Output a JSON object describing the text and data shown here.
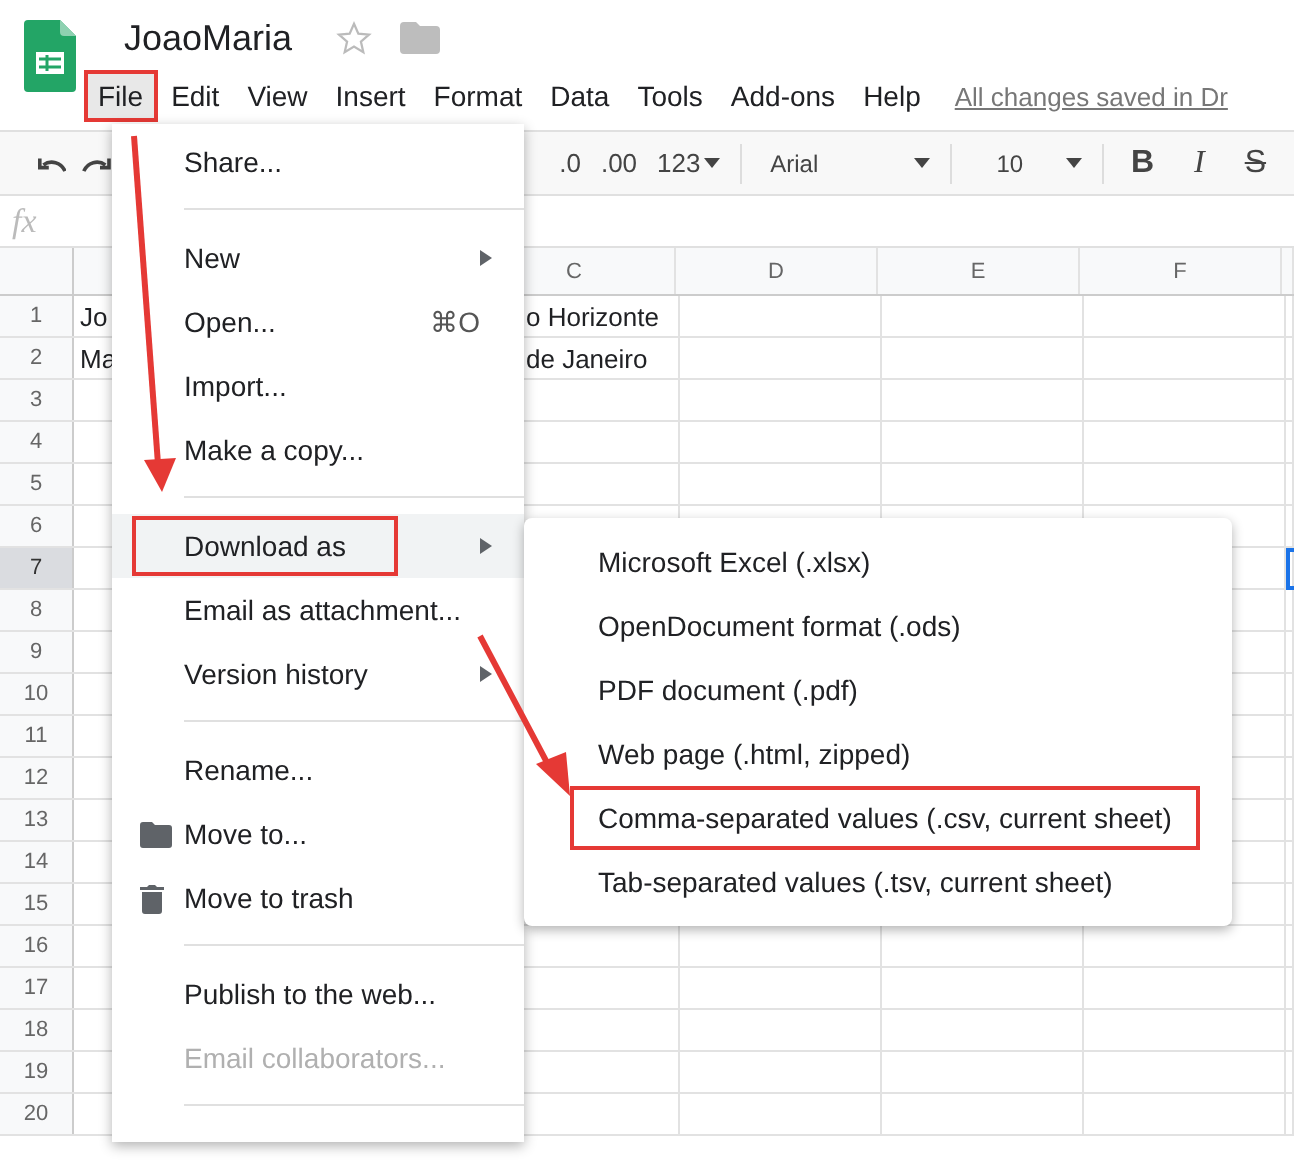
{
  "document": {
    "title": "JoaoMaria",
    "starred": false
  },
  "menubar": [
    {
      "label": "File",
      "selected": true,
      "annotated": true
    },
    {
      "label": "Edit",
      "selected": false,
      "annotated": false
    },
    {
      "label": "View",
      "selected": false,
      "annotated": false
    },
    {
      "label": "Insert",
      "selected": false,
      "annotated": false
    },
    {
      "label": "Format",
      "selected": false,
      "annotated": false
    },
    {
      "label": "Data",
      "selected": false,
      "annotated": false
    },
    {
      "label": "Tools",
      "selected": false,
      "annotated": false
    },
    {
      "label": "Add-ons",
      "selected": false,
      "annotated": false
    },
    {
      "label": "Help",
      "selected": false,
      "annotated": false
    }
  ],
  "save_status": "All changes saved in Dr",
  "toolbar": {
    "decimal_decrease": ".0",
    "decimal_increase": ".00",
    "number_format": "123",
    "font": "Arial",
    "font_size": "10",
    "bold": "B",
    "italic": "I",
    "strikethrough": "S"
  },
  "formula_bar": {
    "label": "fx"
  },
  "columns": [
    "C",
    "D",
    "E",
    "F"
  ],
  "rows": [
    {
      "number": "1",
      "selected": false,
      "a": "Jo",
      "c": "o Horizonte"
    },
    {
      "number": "2",
      "selected": false,
      "a": "Ma",
      "c": "de Janeiro"
    },
    {
      "number": "3",
      "selected": false
    },
    {
      "number": "4",
      "selected": false
    },
    {
      "number": "5",
      "selected": false
    },
    {
      "number": "6",
      "selected": false
    },
    {
      "number": "7",
      "selected": true
    },
    {
      "number": "8",
      "selected": false
    },
    {
      "number": "9",
      "selected": false
    },
    {
      "number": "10",
      "selected": false
    },
    {
      "number": "11",
      "selected": false
    },
    {
      "number": "12",
      "selected": false
    },
    {
      "number": "13",
      "selected": false
    },
    {
      "number": "14",
      "selected": false
    },
    {
      "number": "15",
      "selected": false
    },
    {
      "number": "16",
      "selected": false
    },
    {
      "number": "17",
      "selected": false
    },
    {
      "number": "18",
      "selected": false
    },
    {
      "number": "19",
      "selected": false
    },
    {
      "number": "20",
      "selected": false
    }
  ],
  "file_menu": [
    {
      "kind": "item",
      "label": "Share...",
      "submenu": false,
      "disabled": false,
      "selected": false,
      "annotated": false
    },
    {
      "kind": "divider"
    },
    {
      "kind": "item",
      "label": "New",
      "submenu": true,
      "disabled": false,
      "selected": false,
      "annotated": false
    },
    {
      "kind": "item",
      "label": "Open...",
      "shortcut": "⌘O",
      "submenu": false,
      "disabled": false,
      "selected": false,
      "annotated": false
    },
    {
      "kind": "item",
      "label": "Import...",
      "submenu": false,
      "disabled": false,
      "selected": false,
      "annotated": false
    },
    {
      "kind": "item",
      "label": "Make a copy...",
      "submenu": false,
      "disabled": false,
      "selected": false,
      "annotated": false
    },
    {
      "kind": "divider"
    },
    {
      "kind": "item",
      "label": "Download as",
      "submenu": true,
      "disabled": false,
      "selected": true,
      "annotated": true
    },
    {
      "kind": "item",
      "label": "Email as attachment...",
      "submenu": false,
      "disabled": false,
      "selected": false,
      "annotated": false
    },
    {
      "kind": "item",
      "label": "Version history",
      "submenu": true,
      "disabled": false,
      "selected": false,
      "annotated": false
    },
    {
      "kind": "divider"
    },
    {
      "kind": "item",
      "label": "Rename...",
      "submenu": false,
      "disabled": false,
      "selected": false,
      "annotated": false
    },
    {
      "kind": "folder",
      "label": "Move to...",
      "submenu": false,
      "disabled": false,
      "selected": false,
      "annotated": false
    },
    {
      "kind": "trash",
      "label": "Move to trash",
      "submenu": false,
      "disabled": false,
      "selected": false,
      "annotated": false
    },
    {
      "kind": "divider"
    },
    {
      "kind": "item",
      "label": "Publish to the web...",
      "submenu": false,
      "disabled": false,
      "selected": false,
      "annotated": false
    },
    {
      "kind": "item",
      "label": "Email collaborators...",
      "submenu": false,
      "disabled": true,
      "selected": false,
      "annotated": false
    },
    {
      "kind": "divider"
    }
  ],
  "download_submenu": [
    {
      "label": "Microsoft Excel (.xlsx)",
      "annotated": false
    },
    {
      "label": "OpenDocument format (.ods)",
      "annotated": false
    },
    {
      "label": "PDF document (.pdf)",
      "annotated": false
    },
    {
      "label": "Web page (.html, zipped)",
      "annotated": false
    },
    {
      "label": "Comma-separated values (.csv, current sheet)",
      "annotated": true
    },
    {
      "label": "Tab-separated values (.tsv, current sheet)",
      "annotated": false
    }
  ]
}
